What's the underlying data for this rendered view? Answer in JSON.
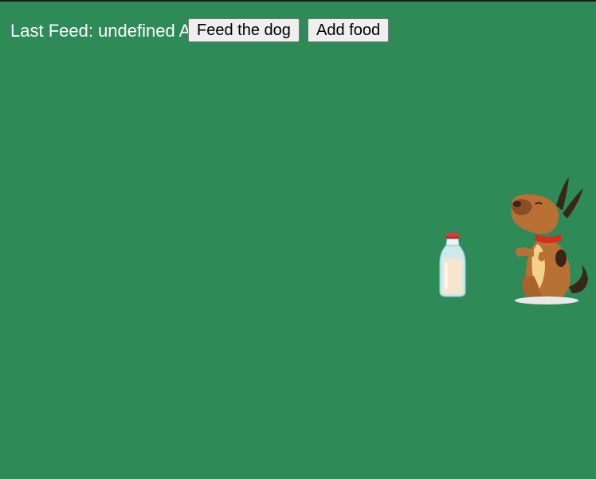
{
  "game": {
    "status_text": "Last Feed: undefined AM",
    "feed_button_label": "Feed the dog",
    "add_button_label": "Add food",
    "background_color": "#2e8a57",
    "sprites": {
      "food": "milk-bottle-icon",
      "pet": "dog-icon"
    }
  }
}
